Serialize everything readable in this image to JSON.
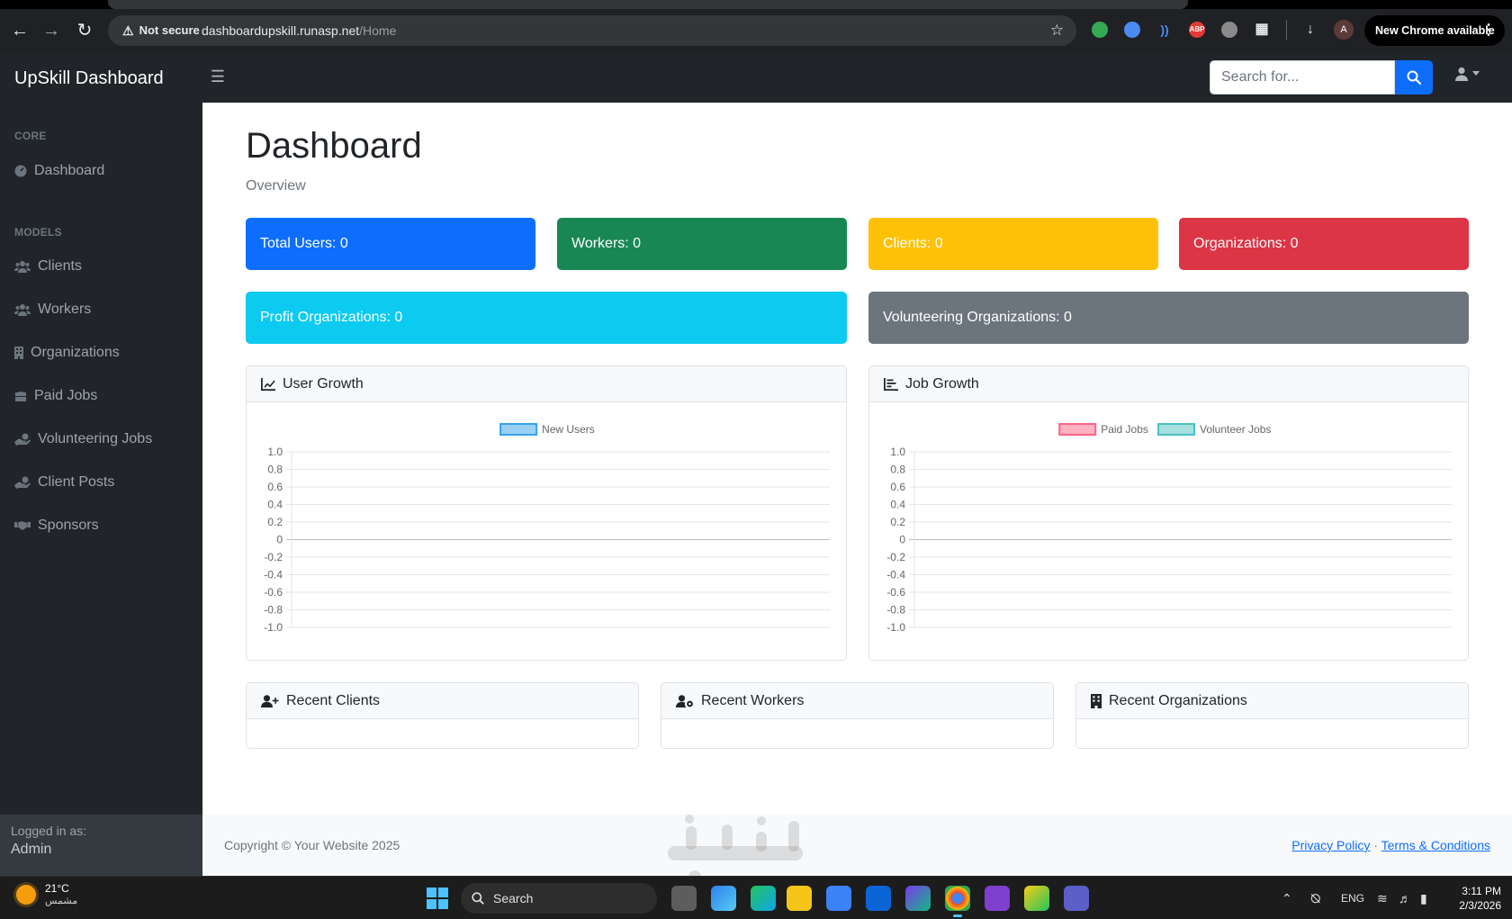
{
  "browser": {
    "not_secure_label": "Not secure",
    "url_host": "dashboardupskill.runasp.net",
    "url_path": "/Home",
    "profile_initial": "A",
    "extension_abp_label": "ABP",
    "update_label": "New Chrome available"
  },
  "navbar": {
    "brand": "UpSkill Dashboard",
    "search_placeholder": "Search for..."
  },
  "sidebar": {
    "core_heading": "CORE",
    "core_items": [
      {
        "label": "Dashboard",
        "icon": "dashboard-gauge-icon"
      }
    ],
    "models_heading": "MODELS",
    "model_items": [
      {
        "label": "Clients",
        "icon": "users-icon"
      },
      {
        "label": "Workers",
        "icon": "users-icon"
      },
      {
        "label": "Organizations",
        "icon": "building-icon"
      },
      {
        "label": "Paid Jobs",
        "icon": "briefcase-icon"
      },
      {
        "label": "Volunteering Jobs",
        "icon": "hand-holding-icon"
      },
      {
        "label": "Client Posts",
        "icon": "hand-holding-icon"
      },
      {
        "label": "Sponsors",
        "icon": "handshake-icon"
      }
    ],
    "footer_label": "Logged in as:",
    "footer_user": "Admin"
  },
  "main": {
    "title": "Dashboard",
    "breadcrumb": "Overview",
    "stats": [
      {
        "label": "Total Users: 0",
        "color": "#0d6efd"
      },
      {
        "label": "Workers: 0",
        "color": "#198754"
      },
      {
        "label": "Clients: 0",
        "color": "#ffc107"
      },
      {
        "label": "Organizations: 0",
        "color": "#dc3545"
      },
      {
        "label": "Profit Organizations: 0",
        "color": "#0dcaf0"
      },
      {
        "label": "Volunteering Organizations: 0",
        "color": "#6c757d"
      }
    ],
    "user_growth_title": "User Growth",
    "job_growth_title": "Job Growth",
    "recent_clients_title": "Recent Clients",
    "recent_workers_title": "Recent Workers",
    "recent_orgs_title": "Recent Organizations"
  },
  "chart_data": [
    {
      "type": "line",
      "title": "User Growth",
      "categories": [],
      "series": [
        {
          "name": "New Users",
          "values": [],
          "fill": "#9ad0f5",
          "stroke": "#36a2eb"
        }
      ],
      "yticks": [
        "1.0",
        "0.8",
        "0.6",
        "0.4",
        "0.2",
        "0",
        "-0.2",
        "-0.4",
        "-0.6",
        "-0.8",
        "-1.0"
      ],
      "ylim": [
        -1,
        1
      ],
      "grid": true,
      "legend": "top-center"
    },
    {
      "type": "bar",
      "title": "Job Growth",
      "categories": [],
      "series": [
        {
          "name": "Paid Jobs",
          "values": [],
          "fill": "#ffb1c1",
          "stroke": "#ff6384"
        },
        {
          "name": "Volunteer Jobs",
          "values": [],
          "fill": "#a5dfdf",
          "stroke": "#4bc0c0"
        }
      ],
      "yticks": [
        "1.0",
        "0.8",
        "0.6",
        "0.4",
        "0.2",
        "0",
        "-0.2",
        "-0.4",
        "-0.6",
        "-0.8",
        "-1.0"
      ],
      "ylim": [
        -1,
        1
      ],
      "grid": true,
      "legend": "top-center"
    }
  ],
  "footer": {
    "copyright": "Copyright © Your Website 2025",
    "privacy": "Privacy Policy",
    "separator": "·",
    "terms": "Terms & Conditions"
  },
  "taskbar": {
    "temperature": "21°C",
    "weather_desc": "مشمس",
    "search_label": "Search",
    "language": "ENG",
    "time": "3:11 PM",
    "date": "2/3/2026"
  }
}
